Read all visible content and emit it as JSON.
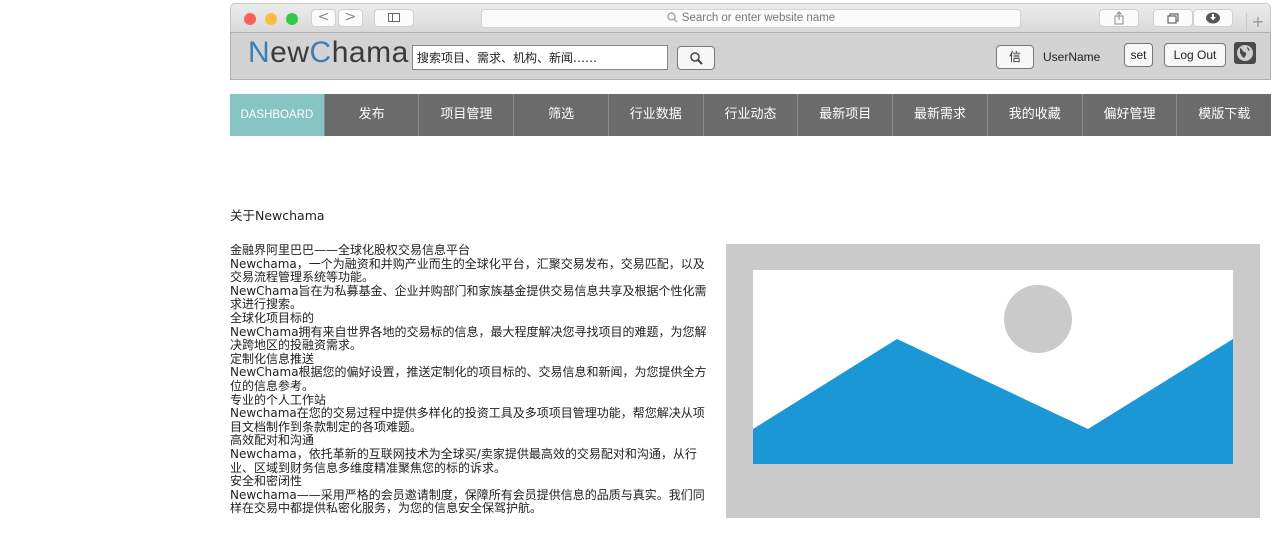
{
  "browser": {
    "address_placeholder": "Search or enter website name",
    "back_glyph": "<",
    "forward_glyph": ">",
    "new_tab_glyph": "+"
  },
  "header": {
    "logo_part1": "N",
    "logo_part2": "ew",
    "logo_part3": "C",
    "logo_part4": "hama",
    "search_value": "搜索项目、需求、机构、新闻……",
    "message_button": "信",
    "username": "UserName",
    "set_button": "set",
    "logout_button": "Log Out"
  },
  "nav": {
    "items": [
      {
        "label": "DASHBOARD"
      },
      {
        "label": "发布"
      },
      {
        "label": "项目管理"
      },
      {
        "label": "筛选"
      },
      {
        "label": "行业数据"
      },
      {
        "label": "行业动态"
      },
      {
        "label": "最新项目"
      },
      {
        "label": "最新需求"
      },
      {
        "label": "我的收藏"
      },
      {
        "label": "偏好管理"
      },
      {
        "label": "模版下载"
      }
    ]
  },
  "content": {
    "about_title": "关于Newchama",
    "paragraphs": [
      "金融界阿里巴巴——全球化股权交易信息平台",
      "Newchama，一个为融资和并购产业而生的全球化平台，汇聚交易发布，交易匹配，以及交易流程管理系统等功能。",
      "NewChama旨在为私募基金、企业并购部门和家族基金提供交易信息共享及根据个性化需求进行搜索。",
      "全球化项目标的",
      "NewChama拥有来自世界各地的交易标的信息，最大程度解决您寻找项目的难题，为您解决跨地区的投融资需求。",
      "定制化信息推送",
      "NewChama根据您的偏好设置，推送定制化的项目标的、交易信息和新闻，为您提供全方位的信息参考。",
      "专业的个人工作站",
      "Newchama在您的交易过程中提供多样化的投资工具及多项项目管理功能，帮您解决从项目文档制作到条款制定的各项难题。",
      "高效配对和沟通",
      "Newchama，依托革新的互联网技术为全球买/卖家提供最高效的交易配对和沟通，从行业、区域到财务信息多维度精准聚焦您的标的诉求。",
      "安全和密闭性",
      "Newchama——采用严格的会员邀请制度，保障所有会员提供信息的品质与真实。我们同样在交易中都提供私密化服务，为您的信息安全保驾护航。"
    ]
  },
  "colors": {
    "nav_bg": "#6b6b6b",
    "nav_active": "#86c5c3",
    "logo_accent": "#3d7fb5",
    "image_mountain": "#1a97d4"
  },
  "icons": [
    "search-icon",
    "share-icon",
    "tabs-icon",
    "download-icon",
    "globe-icon",
    "image-placeholder-icon"
  ]
}
